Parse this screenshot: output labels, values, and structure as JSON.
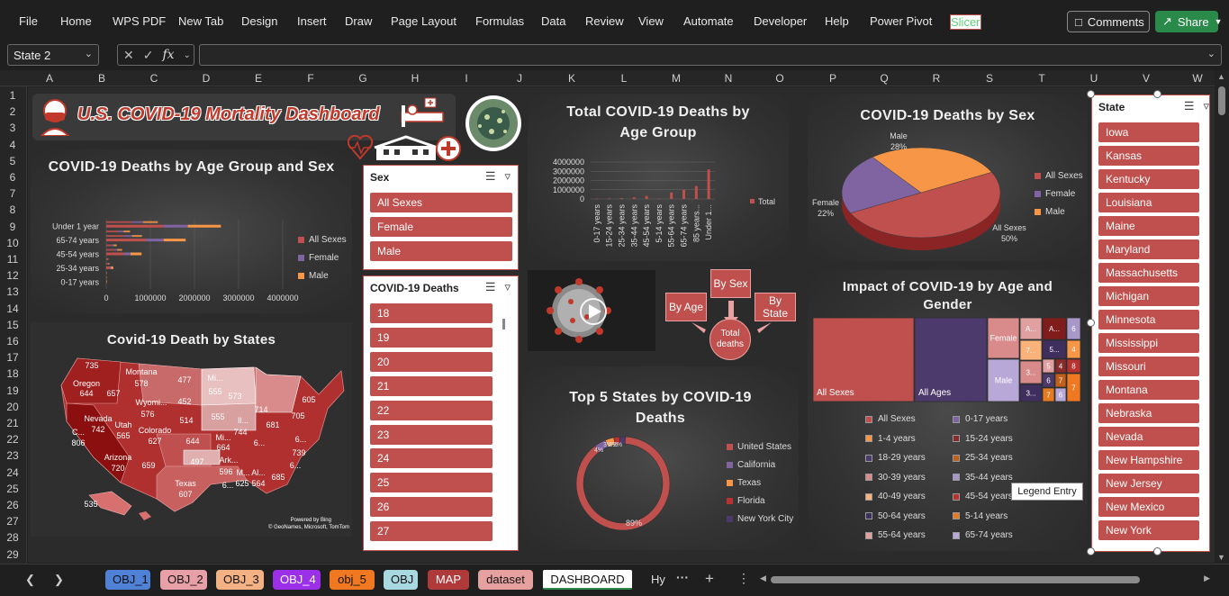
{
  "menu": {
    "items": [
      "File",
      "Home",
      "WPS PDF",
      "New Tab",
      "Design",
      "Insert",
      "Draw",
      "Page Layout",
      "Formulas",
      "Data",
      "Review",
      "View",
      "Automate",
      "Developer",
      "Help",
      "Power Pivot",
      "Slicer"
    ],
    "comments_label": "Comments",
    "share_label": "Share"
  },
  "formula_bar": {
    "name_box": "State 2",
    "fx_label": "fx",
    "formula": ""
  },
  "columns": [
    "A",
    "B",
    "C",
    "D",
    "E",
    "F",
    "G",
    "H",
    "I",
    "J",
    "K",
    "L",
    "M",
    "N",
    "O",
    "P",
    "Q",
    "R",
    "S",
    "T",
    "U",
    "V",
    "W"
  ],
  "rows": [
    "1",
    "2",
    "3",
    "4",
    "5",
    "6",
    "7",
    "8",
    "9",
    "10",
    "11",
    "12",
    "13",
    "14",
    "15",
    "16",
    "17",
    "18",
    "19",
    "20",
    "21",
    "22",
    "23",
    "24",
    "25",
    "26",
    "27",
    "28",
    "29"
  ],
  "dashboard": {
    "title": "U.S. COVID-19 Mortality Dashboard",
    "flow": {
      "by_age": "By Age",
      "by_sex": "By Sex",
      "by_state": "By State",
      "total": "Total deaths"
    },
    "map": {
      "title": "Covid-19 Death by States",
      "labels": [
        {
          "t": "735"
        },
        {
          "t": "Montana"
        },
        {
          "t": "578"
        },
        {
          "t": "477"
        },
        {
          "t": "Mi..."
        },
        {
          "t": "555"
        },
        {
          "t": "573"
        },
        {
          "t": "Oregon"
        },
        {
          "t": "644"
        },
        {
          "t": "657"
        },
        {
          "t": "452"
        },
        {
          "t": "Wyomi..."
        },
        {
          "t": "576"
        },
        {
          "t": "605"
        },
        {
          "t": "Nevada"
        },
        {
          "t": "742"
        },
        {
          "t": "Utah"
        },
        {
          "t": "565"
        },
        {
          "t": "514"
        },
        {
          "t": "555"
        },
        {
          "t": "Il..."
        },
        {
          "t": "744"
        },
        {
          "t": "714"
        },
        {
          "t": "681"
        },
        {
          "t": "705"
        },
        {
          "t": "C..."
        },
        {
          "t": "806"
        },
        {
          "t": "Colorado"
        },
        {
          "t": "627"
        },
        {
          "t": "644"
        },
        {
          "t": "Mi..."
        },
        {
          "t": "664"
        },
        {
          "t": "6..."
        },
        {
          "t": "6..."
        },
        {
          "t": "739"
        },
        {
          "t": "Arizona"
        },
        {
          "t": "720"
        },
        {
          "t": "659"
        },
        {
          "t": "497"
        },
        {
          "t": "Ark..."
        },
        {
          "t": "596"
        },
        {
          "t": "M..."
        },
        {
          "t": "Al..."
        },
        {
          "t": "685"
        },
        {
          "t": "6..."
        },
        {
          "t": "Texas"
        },
        {
          "t": "607"
        },
        {
          "t": "6..."
        },
        {
          "t": "625"
        },
        {
          "t": "564"
        },
        {
          "t": "535"
        }
      ],
      "attribution_1": "Powered by Bing",
      "attribution_2": "© GeoNames, Microsoft, TomTom"
    }
  },
  "slicers": {
    "sex": {
      "header": "Sex",
      "items": [
        "All Sexes",
        "Female",
        "Male"
      ]
    },
    "deaths": {
      "header": "COVID-19 Deaths",
      "items": [
        "18",
        "19",
        "20",
        "21",
        "22",
        "23",
        "24",
        "25",
        "26",
        "27"
      ]
    },
    "state": {
      "header": "State",
      "items": [
        "Iowa",
        "Kansas",
        "Kentucky",
        "Louisiana",
        "Maine",
        "Maryland",
        "Massachusetts",
        "Michigan",
        "Minnesota",
        "Mississippi",
        "Missouri",
        "Montana",
        "Nebraska",
        "Nevada",
        "New Hampshire",
        "New Jersey",
        "New Mexico",
        "New York"
      ]
    }
  },
  "treemap": {
    "labels": [
      "All Sexes",
      "All Ages",
      "Female",
      "Male",
      "A...",
      "A...",
      "6",
      "7...",
      "5...",
      "4",
      "3...",
      "5",
      "4",
      "8",
      "6",
      "7",
      "3...",
      "7",
      "6",
      "7"
    ]
  },
  "tooltip": "Legend Entry",
  "sheet_tabs": [
    {
      "label": "OBJ_1",
      "color": "#4f81d6"
    },
    {
      "label": "OBJ_2",
      "color": "#e8a0a8"
    },
    {
      "label": "OBJ_3",
      "color": "#f4b183"
    },
    {
      "label": "OBJ_4",
      "color": "#9b30e8"
    },
    {
      "label": "obj_5",
      "color": "#f07820"
    },
    {
      "label": "OBJ",
      "color": "#a8d8e0"
    },
    {
      "label": "MAP",
      "color": "#b03a3a"
    },
    {
      "label": "dataset",
      "color": "#e6a0a0"
    },
    {
      "label": "DASHBOARD",
      "color": "#ffffff"
    },
    {
      "label": "Hy",
      "color": ""
    }
  ],
  "colors": {
    "red": "#c0504d",
    "purple": "#8064a2",
    "orange": "#f79646",
    "darkred": "#7f1d1d"
  },
  "chart_data": [
    {
      "type": "bar",
      "title": "COVID-19 Deaths by Age Group and Sex",
      "orientation": "horizontal",
      "categories": [
        "0-17 years",
        "25-34 years",
        "45-54 years",
        "65-74 years",
        "Under 1 year"
      ],
      "xticks": [
        "0",
        "1000000",
        "2000000",
        "3000000",
        "4000000"
      ],
      "xlim": [
        0,
        4000000
      ],
      "series": [
        {
          "name": "All Sexes",
          "color": "#c0504d",
          "values": [
            1000,
            80000,
            400000,
            900000,
            1300000
          ]
        },
        {
          "name": "Female",
          "color": "#8064a2",
          "values": [
            500,
            30000,
            150000,
            400000,
            550000
          ]
        },
        {
          "name": "Male",
          "color": "#f79646",
          "values": [
            500,
            50000,
            250000,
            500000,
            750000
          ]
        }
      ],
      "legend": "right"
    },
    {
      "type": "bar",
      "title": "Total COVID-19 Deaths by Age Group",
      "categories": [
        "0-17 years",
        "15-24 years",
        "25-34 years",
        "35-44 years",
        "45-54 years",
        "5-14 years",
        "55-64 years",
        "65-74 years",
        "85 years...",
        "Under 1..."
      ],
      "yticks": [
        "0",
        "1000000",
        "2000000",
        "3000000",
        "4000000"
      ],
      "ylim": [
        0,
        4000000
      ],
      "series": [
        {
          "name": "Total",
          "color": "#c0504d",
          "values": [
            40000,
            60000,
            90000,
            170000,
            320000,
            30000,
            700000,
            1000000,
            1400000,
            3200000
          ]
        }
      ],
      "legend": "right"
    },
    {
      "type": "pie",
      "title": "COVID-19 Deaths by Sex",
      "slices": [
        {
          "name": "All Sexes",
          "value": 50,
          "label": "All Sexes",
          "pct": "50%",
          "color": "#c0504d"
        },
        {
          "name": "Female",
          "value": 22,
          "label": "Female",
          "pct": "22%",
          "color": "#8064a2"
        },
        {
          "name": "Male",
          "value": 28,
          "label": "Male",
          "pct": "28%",
          "color": "#f79646"
        }
      ],
      "legend": "right"
    },
    {
      "type": "pie",
      "title": "Top 5 States by COVID-19 Deaths",
      "donut": true,
      "slices": [
        {
          "name": "United States",
          "value": 89,
          "pct": "89%",
          "color": "#c0504d"
        },
        {
          "name": "California",
          "value": 4,
          "pct": "4%",
          "color": "#8064a2"
        },
        {
          "name": "Texas",
          "value": 3,
          "pct": "3%",
          "color": "#f79646"
        },
        {
          "name": "Florida",
          "value": 2,
          "pct": "2%",
          "color": "#b83232"
        },
        {
          "name": "New York City",
          "value": 2,
          "pct": "2%",
          "color": "#4b3a6b"
        }
      ],
      "legend": "right"
    },
    {
      "type": "treemap",
      "title": "Impact of COVID-19 by Age and Gender",
      "legend_items": [
        {
          "name": "All Sexes",
          "color": "#c0504d"
        },
        {
          "name": "0-17 years",
          "color": "#8064a2"
        },
        {
          "name": "1-4 years",
          "color": "#f79646"
        },
        {
          "name": "15-24 years",
          "color": "#8b2a2a"
        },
        {
          "name": "18-29 years",
          "color": "#4b3a6b"
        },
        {
          "name": "25-34 years",
          "color": "#c0601a"
        },
        {
          "name": "30-39 years",
          "color": "#d98a8a"
        },
        {
          "name": "35-44 years",
          "color": "#a898c8"
        },
        {
          "name": "40-49 years",
          "color": "#f9b27a"
        },
        {
          "name": "45-54 years",
          "color": "#b83232"
        },
        {
          "name": "50-64 years",
          "color": "#3f2f5f"
        },
        {
          "name": "5-14 years",
          "color": "#e57a20"
        },
        {
          "name": "55-64 years",
          "color": "#e0a0a0"
        },
        {
          "name": "65-74 years",
          "color": "#b8a8d8"
        }
      ]
    }
  ]
}
